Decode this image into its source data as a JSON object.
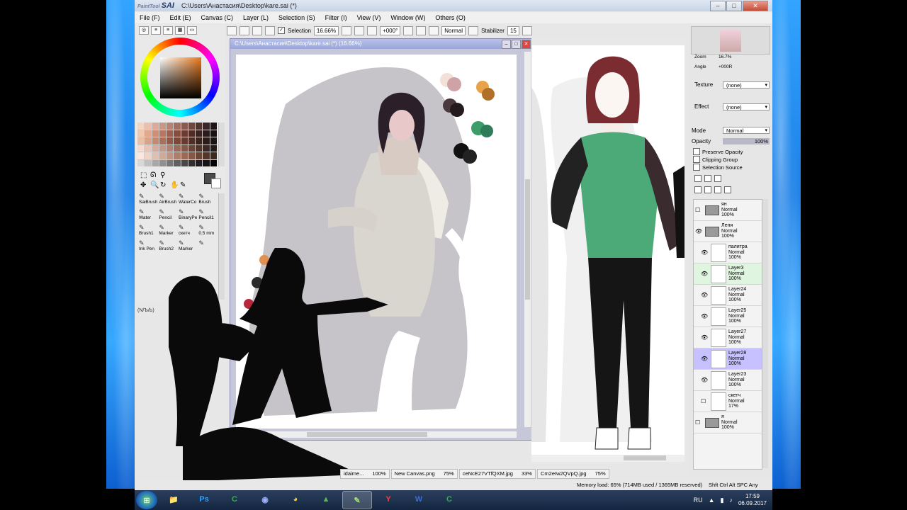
{
  "window": {
    "logo_small": "PaintTool",
    "logo": "SAI",
    "title": "C:\\Users\\Анастасия\\Desktop\\kare.sai (*)"
  },
  "menu": [
    "File (F)",
    "Edit (E)",
    "Canvas (C)",
    "Layer (L)",
    "Selection (S)",
    "Filter (I)",
    "View (V)",
    "Window (W)",
    "Others (O)"
  ],
  "toolbar": {
    "selection_label": "Selection",
    "selection_checked": true,
    "zoom": "16.66%",
    "angle": "+000°",
    "blend": "Normal",
    "stabilizer_label": "Stabilizer",
    "stabilizer_value": "15"
  },
  "left_panel": {
    "brushes": [
      {
        "name": "SaiBrush",
        "size": ""
      },
      {
        "name": "AirBrush",
        "size": ""
      },
      {
        "name": "WaterCo",
        "size": ""
      },
      {
        "name": "Brush",
        "size": ""
      },
      {
        "name": "Water",
        "size": ""
      },
      {
        "name": "Pencil",
        "size": ""
      },
      {
        "name": "BinaryPe",
        "size": ""
      },
      {
        "name": "Pencil1",
        "size": ""
      },
      {
        "name": "Brush1",
        "size": ""
      },
      {
        "name": "Marker",
        "size": ""
      },
      {
        "name": "скетч",
        "size": ""
      },
      {
        "name": "0.5 mm",
        "size": ""
      },
      {
        "name": "Ink Pen",
        "size": ""
      },
      {
        "name": "Brush2",
        "size": ""
      },
      {
        "name": "Marker",
        "size": ""
      },
      {
        "name": "",
        "size": ""
      }
    ],
    "bottom_label": "(N/Ъ/Ь)"
  },
  "document": {
    "title": "C:\\Users\\Анастасия\\Desktop\\kare.sai (*) (16.66%)"
  },
  "right_panel": {
    "zoom_label": "Zoom",
    "zoom_value": "16.7%",
    "angle_label": "Angle",
    "angle_value": "+000R",
    "texture_label": "Texture",
    "texture_value": "(none)",
    "effect_label": "Effect",
    "effect_value": "(none)",
    "mode_label": "Mode",
    "mode_value": "Normal",
    "opacity_label": "Opacity",
    "opacity_value": "100%",
    "preserve_opacity": "Preserve Opacity",
    "clipping_group": "Clipping Group",
    "selection_source": "Selection Source"
  },
  "layers": [
    {
      "name": "ян",
      "mode": "Normal",
      "opacity": "100%",
      "type": "folder",
      "visible": false,
      "selected": false,
      "indent": false
    },
    {
      "name": "Леня",
      "mode": "Normal",
      "opacity": "100%",
      "type": "folder",
      "visible": true,
      "selected": false,
      "indent": false
    },
    {
      "name": "палитра",
      "mode": "Normal",
      "opacity": "100%",
      "type": "layer",
      "visible": true,
      "selected": false,
      "indent": true
    },
    {
      "name": "Layer3",
      "mode": "Normal",
      "opacity": "100%",
      "type": "layer",
      "visible": true,
      "selected": false,
      "indent": true,
      "highlight": true
    },
    {
      "name": "Layer24",
      "mode": "Normal",
      "opacity": "100%",
      "type": "layer",
      "visible": true,
      "selected": false,
      "indent": true
    },
    {
      "name": "Layer25",
      "mode": "Normal",
      "opacity": "100%",
      "type": "layer",
      "visible": true,
      "selected": false,
      "indent": true
    },
    {
      "name": "Layer27",
      "mode": "Normal",
      "opacity": "100%",
      "type": "layer",
      "visible": true,
      "selected": false,
      "indent": true
    },
    {
      "name": "Layer28",
      "mode": "Normal",
      "opacity": "100%",
      "type": "layer",
      "visible": true,
      "selected": true,
      "indent": true
    },
    {
      "name": "Layer23",
      "mode": "Normal",
      "opacity": "100%",
      "type": "layer",
      "visible": true,
      "selected": false,
      "indent": true
    },
    {
      "name": "скетч",
      "mode": "Normal",
      "opacity": "17%",
      "type": "layer",
      "visible": false,
      "selected": false,
      "indent": true
    },
    {
      "name": "я",
      "mode": "Normal",
      "opacity": "100%",
      "type": "folder",
      "visible": false,
      "selected": false,
      "indent": false
    }
  ],
  "tabs": [
    {
      "name": "idaime...",
      "pct": "100%"
    },
    {
      "name": "New Canvas.png",
      "pct": "75%"
    },
    {
      "name": "ceNcE27VTfQXM.jpg",
      "pct": "33%"
    },
    {
      "name": "Cm2eIw2QVpQ.jpg",
      "pct": "75%"
    }
  ],
  "status": {
    "memory": "Memory load: 65% (714MB used / 1365MB reserved)",
    "keys": "Shft Ctrl Alt SPC Any"
  },
  "taskbar": {
    "apps": [
      {
        "name": "explorer",
        "glyph": "📁"
      },
      {
        "name": "photoshop",
        "glyph": "Ps"
      },
      {
        "name": "camtasia",
        "glyph": "C"
      },
      {
        "name": "discord",
        "glyph": "◉"
      },
      {
        "name": "chrome",
        "glyph": "◕"
      },
      {
        "name": "maps",
        "glyph": "▲"
      },
      {
        "name": "paint-tool-sai",
        "glyph": "✎"
      },
      {
        "name": "yandex",
        "glyph": "Y"
      },
      {
        "name": "word",
        "glyph": "W"
      },
      {
        "name": "camtasia-recorder",
        "glyph": "C"
      }
    ],
    "language": "RU",
    "time": "17:59",
    "date": "06.09.2017"
  },
  "colors": {
    "fg": "#4a4a4a",
    "bg": "#ffffff",
    "accent": "#c7c2ff",
    "dress": "#4caa78"
  }
}
